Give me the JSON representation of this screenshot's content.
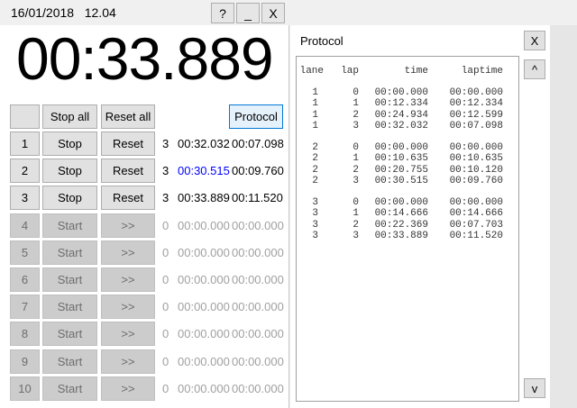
{
  "titlebar": {
    "datetime": "16/01/2018   12.04",
    "help_label": "?",
    "minimize_label": "_",
    "close_label": "X"
  },
  "clock": "00:33.889",
  "controls": {
    "blank_label": "",
    "stop_all_label": "Stop all",
    "reset_all_label": "Reset all",
    "protocol_label": "Protocol"
  },
  "lanes": [
    {
      "num": "1",
      "action": "Stop",
      "second": "Reset",
      "count": "3",
      "time": "00:32.032",
      "laptime": "00:07.098",
      "active": true,
      "highlight": false
    },
    {
      "num": "2",
      "action": "Stop",
      "second": "Reset",
      "count": "3",
      "time": "00:30.515",
      "laptime": "00:09.760",
      "active": true,
      "highlight": true
    },
    {
      "num": "3",
      "action": "Stop",
      "second": "Reset",
      "count": "3",
      "time": "00:33.889",
      "laptime": "00:11.520",
      "active": true,
      "highlight": false
    },
    {
      "num": "4",
      "action": "Start",
      "second": ">>",
      "count": "0",
      "time": "00:00.000",
      "laptime": "00:00.000",
      "active": false,
      "highlight": false
    },
    {
      "num": "5",
      "action": "Start",
      "second": ">>",
      "count": "0",
      "time": "00:00.000",
      "laptime": "00:00.000",
      "active": false,
      "highlight": false
    },
    {
      "num": "6",
      "action": "Start",
      "second": ">>",
      "count": "0",
      "time": "00:00.000",
      "laptime": "00:00.000",
      "active": false,
      "highlight": false
    },
    {
      "num": "7",
      "action": "Start",
      "second": ">>",
      "count": "0",
      "time": "00:00.000",
      "laptime": "00:00.000",
      "active": false,
      "highlight": false
    },
    {
      "num": "8",
      "action": "Start",
      "second": ">>",
      "count": "0",
      "time": "00:00.000",
      "laptime": "00:00.000",
      "active": false,
      "highlight": false
    },
    {
      "num": "9",
      "action": "Start",
      "second": ">>",
      "count": "0",
      "time": "00:00.000",
      "laptime": "00:00.000",
      "active": false,
      "highlight": false
    },
    {
      "num": "10",
      "action": "Start",
      "second": ">>",
      "count": "0",
      "time": "00:00.000",
      "laptime": "00:00.000",
      "active": false,
      "highlight": false
    }
  ],
  "protocol": {
    "title": "Protocol",
    "close_label": "X",
    "up_label": "^",
    "down_label": "v",
    "headers": [
      "lane",
      "lap",
      "time",
      "laptime"
    ],
    "groups": [
      [
        [
          "1",
          "0",
          "00:00.000",
          "00:00.000"
        ],
        [
          "1",
          "1",
          "00:12.334",
          "00:12.334"
        ],
        [
          "1",
          "2",
          "00:24.934",
          "00:12.599"
        ],
        [
          "1",
          "3",
          "00:32.032",
          "00:07.098"
        ]
      ],
      [
        [
          "2",
          "0",
          "00:00.000",
          "00:00.000"
        ],
        [
          "2",
          "1",
          "00:10.635",
          "00:10.635"
        ],
        [
          "2",
          "2",
          "00:20.755",
          "00:10.120"
        ],
        [
          "2",
          "3",
          "00:30.515",
          "00:09.760"
        ]
      ],
      [
        [
          "3",
          "0",
          "00:00.000",
          "00:00.000"
        ],
        [
          "3",
          "1",
          "00:14.666",
          "00:14.666"
        ],
        [
          "3",
          "2",
          "00:22.369",
          "00:07.703"
        ],
        [
          "3",
          "3",
          "00:33.889",
          "00:11.520"
        ]
      ]
    ]
  },
  "colors": {
    "highlight": "#0000ff",
    "disabled_text": "#a0a0a0",
    "focus_border": "#0078d7"
  }
}
